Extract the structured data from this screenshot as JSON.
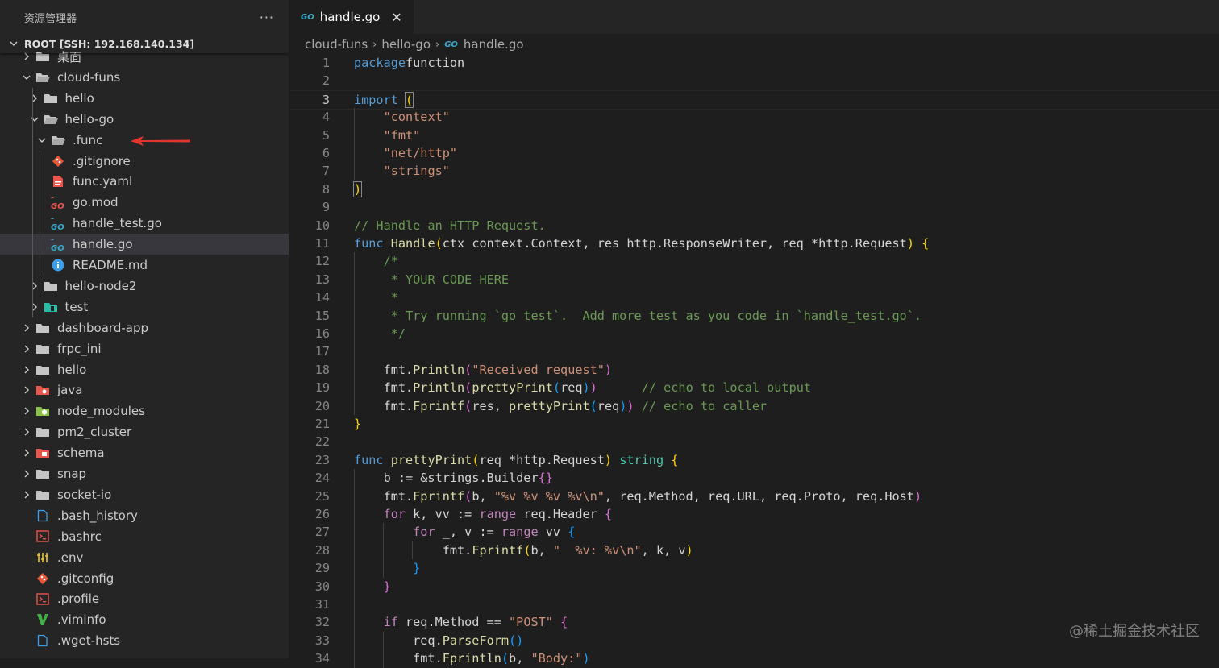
{
  "sidebar": {
    "title": "资源管理器",
    "more": "···",
    "root": "ROOT [SSH: 192.168.140.134]",
    "items": [
      {
        "label": "桌面",
        "icon": "folder-icon",
        "depth": 1,
        "chev": "right"
      },
      {
        "label": "cloud-funs",
        "icon": "folder-open-icon",
        "depth": 1,
        "chev": "down"
      },
      {
        "label": "hello",
        "icon": "folder-icon",
        "depth": 2,
        "chev": "right"
      },
      {
        "label": "hello-go",
        "icon": "folder-open-icon",
        "depth": 2,
        "chev": "down"
      },
      {
        "label": ".func",
        "icon": "folder-open-icon",
        "depth": 3,
        "chev": "down"
      },
      {
        "label": ".gitignore",
        "icon": "git-icon",
        "depth": 3,
        "chev": ""
      },
      {
        "label": "func.yaml",
        "icon": "yaml-icon",
        "depth": 3,
        "chev": ""
      },
      {
        "label": "go.mod",
        "icon": "gomod-icon",
        "depth": 3,
        "chev": ""
      },
      {
        "label": "handle_test.go",
        "icon": "go-file-icon",
        "depth": 3,
        "chev": ""
      },
      {
        "label": "handle.go",
        "icon": "go-file-icon",
        "depth": 3,
        "chev": "",
        "selected": true
      },
      {
        "label": "README.md",
        "icon": "info-icon",
        "depth": 3,
        "chev": ""
      },
      {
        "label": "hello-node2",
        "icon": "folder-icon",
        "depth": 2,
        "chev": "right"
      },
      {
        "label": "test",
        "icon": "test-folder-icon",
        "depth": 2,
        "chev": "right"
      },
      {
        "label": "dashboard-app",
        "icon": "folder-icon",
        "depth": 1,
        "chev": "right"
      },
      {
        "label": "frpc_ini",
        "icon": "folder-icon",
        "depth": 1,
        "chev": "right"
      },
      {
        "label": "hello",
        "icon": "folder-icon",
        "depth": 1,
        "chev": "right"
      },
      {
        "label": "java",
        "icon": "java-folder-icon",
        "depth": 1,
        "chev": "right"
      },
      {
        "label": "node_modules",
        "icon": "node-folder-icon",
        "depth": 1,
        "chev": "right"
      },
      {
        "label": "pm2_cluster",
        "icon": "folder-icon",
        "depth": 1,
        "chev": "right"
      },
      {
        "label": "schema",
        "icon": "schema-folder-icon",
        "depth": 1,
        "chev": "right"
      },
      {
        "label": "snap",
        "icon": "folder-icon",
        "depth": 1,
        "chev": "right"
      },
      {
        "label": "socket-io",
        "icon": "folder-icon",
        "depth": 1,
        "chev": "right"
      },
      {
        "label": ".bash_history",
        "icon": "file-icon",
        "depth": 1,
        "chev": ""
      },
      {
        "label": ".bashrc",
        "icon": "terminal-icon",
        "depth": 1,
        "chev": ""
      },
      {
        "label": ".env",
        "icon": "env-icon",
        "depth": 1,
        "chev": ""
      },
      {
        "label": ".gitconfig",
        "icon": "git-icon",
        "depth": 1,
        "chev": ""
      },
      {
        "label": ".profile",
        "icon": "terminal-icon",
        "depth": 1,
        "chev": ""
      },
      {
        "label": ".viminfo",
        "icon": "vim-icon",
        "depth": 1,
        "chev": ""
      },
      {
        "label": ".wget-hsts",
        "icon": "file-icon",
        "depth": 1,
        "chev": ""
      }
    ]
  },
  "editor": {
    "tab": {
      "label": "handle.go",
      "icon_text": "GO",
      "close": "✕"
    },
    "breadcrumb": [
      "cloud-funs",
      "hello-go",
      "handle.go"
    ],
    "active_line": 3,
    "lines": [
      [
        [
          "k",
          "package"
        ],
        [
          "",
          "function"
        ]
      ],
      [],
      [
        [
          "k",
          "import"
        ],
        [
          "",
          ""
        ],
        [
          "bm p1",
          "("
        ]
      ],
      [
        [
          "",
          "    "
        ],
        [
          "s",
          "\"context\""
        ]
      ],
      [
        [
          "",
          "    "
        ],
        [
          "s",
          "\"fmt\""
        ]
      ],
      [
        [
          "",
          "    "
        ],
        [
          "s",
          "\"net/http\""
        ]
      ],
      [
        [
          "",
          "    "
        ],
        [
          "s",
          "\"strings\""
        ]
      ],
      [
        [
          "bm p1",
          ")"
        ]
      ],
      [],
      [
        [
          "m",
          "// Handle an HTTP Request."
        ]
      ],
      [
        [
          "k",
          "func"
        ],
        [
          "f",
          " Handle"
        ],
        [
          "p1",
          "("
        ],
        [
          "",
          "ctx context.Context, res http.ResponseWriter, req *http.Request"
        ],
        [
          "p1",
          ")"
        ],
        [
          "",
          " "
        ],
        [
          "p1",
          "{"
        ]
      ],
      [
        [
          "",
          "    "
        ],
        [
          "m",
          "/*"
        ]
      ],
      [
        [
          "",
          "    "
        ],
        [
          "m",
          " * YOUR CODE HERE"
        ]
      ],
      [
        [
          "",
          "    "
        ],
        [
          "m",
          " *"
        ]
      ],
      [
        [
          "",
          "    "
        ],
        [
          "m",
          " * Try running `go test`.  Add more test as you code in `handle_test.go`."
        ]
      ],
      [
        [
          "",
          "    "
        ],
        [
          "m",
          " */"
        ]
      ],
      [],
      [
        [
          "",
          "    fmt."
        ],
        [
          "f",
          "Println"
        ],
        [
          "p2",
          "("
        ],
        [
          "s",
          "\"Received request\""
        ],
        [
          "p2",
          ")"
        ]
      ],
      [
        [
          "",
          "    fmt."
        ],
        [
          "f",
          "Println"
        ],
        [
          "p2",
          "("
        ],
        [
          "f",
          "prettyPrint"
        ],
        [
          "p3",
          "("
        ],
        [
          "",
          "req"
        ],
        [
          "p3",
          ")"
        ],
        [
          "p2",
          ")"
        ],
        [
          "",
          "      "
        ],
        [
          "m",
          "// echo to local output"
        ]
      ],
      [
        [
          "",
          "    fmt."
        ],
        [
          "f",
          "Fprintf"
        ],
        [
          "p2",
          "("
        ],
        [
          "",
          "res, "
        ],
        [
          "f",
          "prettyPrint"
        ],
        [
          "p3",
          "("
        ],
        [
          "",
          "req"
        ],
        [
          "p3",
          ")"
        ],
        [
          "p2",
          ")"
        ],
        [
          "",
          " "
        ],
        [
          "m",
          "// echo to caller"
        ]
      ],
      [
        [
          "p1",
          "}"
        ]
      ],
      [],
      [
        [
          "k",
          "func"
        ],
        [
          "f",
          " prettyPrint"
        ],
        [
          "p1",
          "("
        ],
        [
          "",
          "req *http.Request"
        ],
        [
          "p1",
          ")"
        ],
        [
          "",
          " "
        ],
        [
          "t",
          "string"
        ],
        [
          "",
          " "
        ],
        [
          "p1",
          "{"
        ]
      ],
      [
        [
          "",
          "    b := &strings.Builder"
        ],
        [
          "p2",
          "{}"
        ]
      ],
      [
        [
          "",
          "    fmt."
        ],
        [
          "f",
          "Fprintf"
        ],
        [
          "p2",
          "("
        ],
        [
          "",
          "b, "
        ],
        [
          "s",
          "\"%v %v %v %v\\n\""
        ],
        [
          "",
          ", req.Method, req.URL, req.Proto, req.Host"
        ],
        [
          "p2",
          ")"
        ]
      ],
      [
        [
          "",
          "    "
        ],
        [
          "c",
          "for"
        ],
        [
          "",
          " k, vv := "
        ],
        [
          "c",
          "range"
        ],
        [
          "",
          " req.Header "
        ],
        [
          "p2",
          "{"
        ]
      ],
      [
        [
          "",
          "        "
        ],
        [
          "c",
          "for"
        ],
        [
          "",
          " _, v := "
        ],
        [
          "c",
          "range"
        ],
        [
          "",
          " vv "
        ],
        [
          "p3",
          "{"
        ]
      ],
      [
        [
          "",
          "            fmt."
        ],
        [
          "f",
          "Fprintf"
        ],
        [
          "p1",
          "("
        ],
        [
          "",
          "b, "
        ],
        [
          "s",
          "\"  %v: %v\\n\""
        ],
        [
          "",
          ", k, v"
        ],
        [
          "p1",
          ")"
        ]
      ],
      [
        [
          "",
          "        "
        ],
        [
          "p3",
          "}"
        ]
      ],
      [
        [
          "",
          "    "
        ],
        [
          "p2",
          "}"
        ]
      ],
      [],
      [
        [
          "",
          "    "
        ],
        [
          "c",
          "if"
        ],
        [
          "",
          " req.Method == "
        ],
        [
          "s",
          "\"POST\""
        ],
        [
          "",
          " "
        ],
        [
          "p2",
          "{"
        ]
      ],
      [
        [
          "",
          "        req."
        ],
        [
          "f",
          "ParseForm"
        ],
        [
          "p3",
          "()"
        ]
      ],
      [
        [
          "",
          "        fmt."
        ],
        [
          "f",
          "Fprintln"
        ],
        [
          "p3",
          "("
        ],
        [
          "",
          "b, "
        ],
        [
          "s",
          "\"Body:\""
        ],
        [
          "p3",
          ")"
        ]
      ]
    ]
  },
  "colors": {
    "accent": "#569cd6",
    "selection": "#37373d",
    "arrow": "#e0342c"
  },
  "watermark": "@稀土掘金技术社区"
}
